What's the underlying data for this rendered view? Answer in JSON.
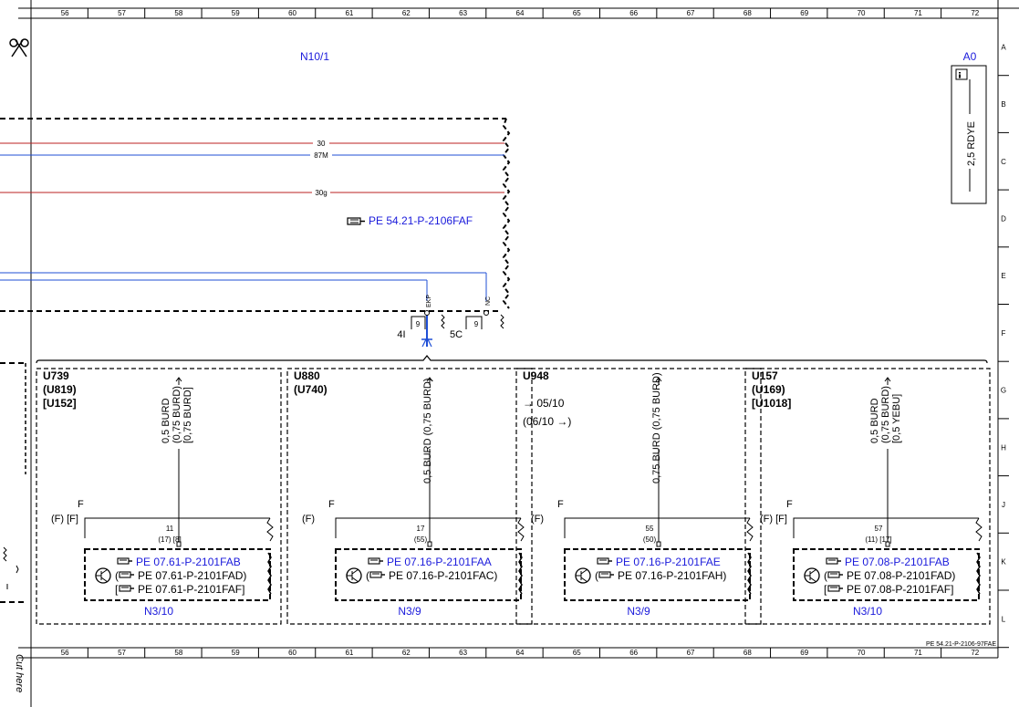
{
  "columns": [
    "56",
    "57",
    "58",
    "59",
    "60",
    "61",
    "62",
    "63",
    "64",
    "65",
    "66",
    "67",
    "68",
    "69",
    "70",
    "71",
    "72"
  ],
  "rows": [
    "A",
    "B",
    "C",
    "D",
    "E",
    "F",
    "G",
    "H",
    "J",
    "K",
    "L"
  ],
  "cut_here": "Cut here",
  "top_module": "N10/1",
  "a0": {
    "label": "A0",
    "wire": "2,5 RDYE"
  },
  "bus_wires": [
    "30",
    "87M",
    "30g"
  ],
  "top_ref": "PE 54.21-P-2106FAF",
  "connector": {
    "pin_left": "9",
    "pin_right": "9",
    "label_left": "4I",
    "label_right": "5C",
    "sig_left": "EKP",
    "sig_right": "NC"
  },
  "sheet_ref": "PE 54.21-P-2106-97FAE",
  "sections": [
    {
      "ids": [
        "U739",
        "(U819)",
        "[U152]"
      ],
      "wire_lines": [
        "0,5 BURD",
        "(0,75 BURD)",
        "[0,75 BURD]"
      ],
      "fuse_labels": [
        "F",
        "(F) [F]"
      ],
      "pin": "11",
      "pin_sub": "(17) [8]",
      "refs": [
        "PE 07.61-P-2101FAB",
        "(PE 07.61-P-2101FAD)",
        "[PE 07.61-P-2101FAF]"
      ],
      "module": "N3/10"
    },
    {
      "ids": [
        "U880",
        "(U740)"
      ],
      "wire_lines": [
        "0,5 BURD (0,75 BURD)"
      ],
      "fuse_labels": [
        "F",
        "(F)"
      ],
      "pin": "17",
      "pin_sub": "(55)",
      "refs": [
        "PE 07.16-P-2101FAA",
        "(PE 07.16-P-2101FAC)"
      ],
      "module": "N3/9"
    },
    {
      "ids": [
        "U948"
      ],
      "arrows": [
        "05/10",
        "(06/10"
      ],
      "wire_lines": [
        "0,75 BURD (0,75 BURD)"
      ],
      "fuse_labels": [
        "F",
        "(F)"
      ],
      "pin": "55",
      "pin_sub": "(50)",
      "refs": [
        "PE 07.16-P-2101FAE",
        "(PE 07.16-P-2101FAH)"
      ],
      "module": "N3/9"
    },
    {
      "ids": [
        "U157",
        "(U169)",
        "[U1018]"
      ],
      "wire_lines": [
        "0,5 BURD",
        "(0,75 BURD)",
        "[0,5 YEBU]"
      ],
      "fuse_labels": [
        "F",
        "(F) [F]"
      ],
      "pin": "57",
      "pin_sub": "(11) [17]",
      "refs": [
        "PE 07.08-P-2101FAB",
        "(PE 07.08-P-2101FAD)",
        "[PE 07.08-P-2101FAF]"
      ],
      "module": "N3/10"
    }
  ]
}
